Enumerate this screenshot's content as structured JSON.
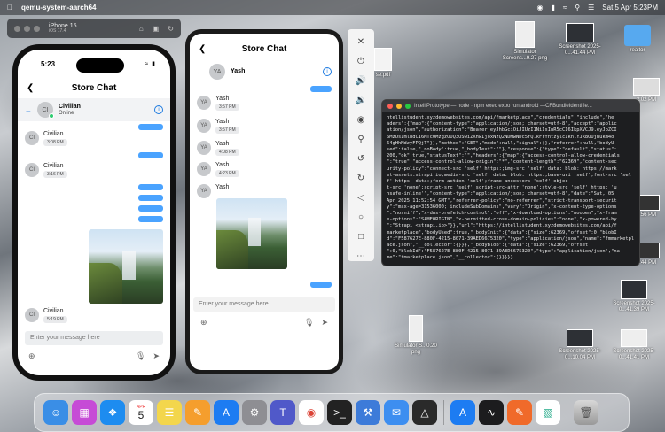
{
  "menubar": {
    "app_name": "qemu-system-aarch64",
    "date_time": "Sat 5 Apr  5:23PM"
  },
  "sim_toolbar": {
    "device_name": "iPhone 15",
    "ios_version": "iOS 17.4"
  },
  "ios": {
    "time": "5:23",
    "title": "Store Chat",
    "contact_initials": "CI",
    "contact_name": "Civilian",
    "contact_status": "Online",
    "senders": [
      {
        "initials": "CI",
        "name": "Civilian",
        "time": "3:08 PM"
      },
      {
        "initials": "CI",
        "name": "Civilian",
        "time": "3:16 PM"
      },
      {
        "initials": "CI",
        "name": "Civilian",
        "time": "5:19 PM"
      }
    ],
    "input_placeholder": "Enter your message here"
  },
  "android": {
    "title": "Store Chat",
    "contact_initials": "YA",
    "contact_name": "Yash",
    "senders": [
      {
        "initials": "YA",
        "name": "Yash",
        "time": "3:57 PM"
      },
      {
        "initials": "YA",
        "name": "Yash",
        "time": "3:57 PM"
      },
      {
        "initials": "YA",
        "name": "Yash",
        "time": "4:08 PM"
      },
      {
        "initials": "YA",
        "name": "Yash",
        "time": "4:23 PM"
      },
      {
        "initials": "YA",
        "name": "Yash",
        "time": ""
      }
    ],
    "input_placeholder": "Enter your message here"
  },
  "terminal": {
    "title": "IntelliPrototype — node · npm exec expo run android —CFBundleIdentifie...",
    "text": "ntellistudent.xyzdemowebsites.com/api/fmarketplace\",\"credentials\":\"include\",\"he\naders\":{\"map\":{\"content-type\":\"application/json; charset=utf-8\",\"accept\":\"applic\nation/json\",\"authorization\":\"Bearer eyJhbGciOiJIUzI1NiIsInR5cCI6IkpXVCJ9.eyJpZCI\n6MzUsImlhdCI6MTc0MzgzODQ3OSwiZXhwIjoxNzQ2NDMwNDc5fQ.kFrfntzylcIknlYJk8OUjhukm4o\n64gHhMdzyFPQjT\"}},\"method\":\"GET\",\"mode\":null,\"signal\":{},\"referrer\":null,\"bodyU\nsed\":false,\"_noBody\":true,\"_bodyText\":\"\"},\"response\":{\"type\":\"default\",\"status\":\n200,\"ok\":true,\"statusText\":\"\",\"headers\":{\"map\":{\"access-control-allow-credentials\n\":\"true\",\"access-control-allow-origin\":\"*\",\"content-length\":\"62369\",\"content-sec\nurity-policy\":\"connect-src 'self' https:;img-src 'self' data: blob: https://mark\net-assets.strapi.io;media-src 'self' data: blob: https:;base-uri 'self';font-src 'self' https: data:;form-action 'self';frame-ancestors 'self';objec\nt-src 'none';script-src 'self' script-src-attr 'none';style-src 'self' https: 'u\nnsafe-inline'\",\"content-type\":\"application/json; charset=utf-8\",\"date\":\"Sat, 05\nApr 2025 11:52:54 GMT\",\"referrer-policy\":\"no-referrer\",\"strict-transport-securit\ny\":\"max-age=31536000; includeSubDomains\",\"vary\":\"Origin\",\"x-content-type-options\n\":\"nosniff\",\"x-dns-prefetch-control\":\"off\",\"x-download-options\":\"noopen\",\"x-fram\ne-options\":\"SAMEORIGIN\",\"x-permitted-cross-domain-policies\":\"none\",\"x-powered-by\n\":\"Strapi <strapi.io>\"}},\"url\":\"https://intellistudent.xyzdemowebsites.com/api/f\nmarketplace\",\"bodyUsed\":true,\"_bodyInit\":{\"data\":{\"size\":62369,\"offset\":0,\"blobI\nd\":\"F587627E-880F-4215-8071-39AED6675320\",\"type\":\"application/json\",\"name\":\"fmmarketplace.json\",\"__collector\":{}}},\"_bodyBlob\":{\"data\":{\"size\":62369,\"offset\n\":0,\"blobId\":\"F587627E-880F-4215-8071-39AED6675320\",\"type\":\"application/json\",\"na\nme\":\"fmarketplace.json\",\"__collector\":{}}}}}"
  },
  "desktop": {
    "icons": [
      {
        "label": "Simulator Screens...9.27 png"
      },
      {
        "label": "Screenshot 2025-0...41.44 PM"
      },
      {
        "label": "realtor"
      },
      {
        "label": "Simulator S...0.20 png"
      },
      {
        "label": "Screenshot 2025-0...10.04 PM"
      },
      {
        "label": "Screenshot 2025-0...41.41 PM"
      },
      {
        "label": "Screenshot 2025-0...41.39 PM"
      },
      {
        "label": "se.pdf"
      },
      {
        "label": "2:02 PM"
      },
      {
        "label": "7:56 PM"
      },
      {
        "label": "1:44 PM"
      }
    ]
  },
  "dock": {
    "calendar_month": "APR",
    "calendar_day": "5"
  }
}
